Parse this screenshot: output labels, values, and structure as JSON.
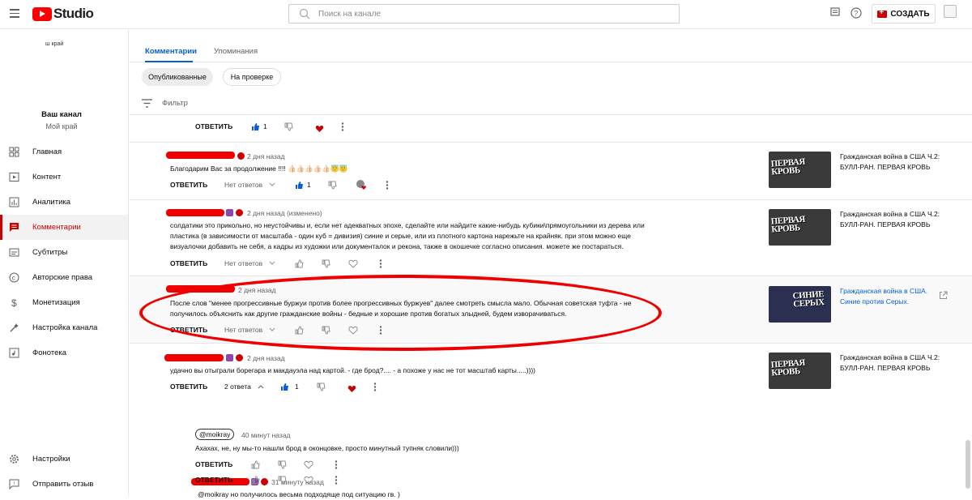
{
  "header": {
    "logo_text": "Studio",
    "search_placeholder": "Поиск на канале",
    "create_label": "СОЗДАТЬ"
  },
  "sidebar": {
    "channel_logo_text": "ш край",
    "channel_title": "Ваш канал",
    "channel_name": "Мой край",
    "items": [
      {
        "label": "Главная",
        "icon": "dashboard-icon"
      },
      {
        "label": "Контент",
        "icon": "content-icon"
      },
      {
        "label": "Аналитика",
        "icon": "analytics-icon"
      },
      {
        "label": "Комментарии",
        "icon": "comments-icon",
        "active": true
      },
      {
        "label": "Субтитры",
        "icon": "subtitles-icon"
      },
      {
        "label": "Авторские права",
        "icon": "copyright-icon"
      },
      {
        "label": "Монетизация",
        "icon": "dollar-icon"
      },
      {
        "label": "Настройка канала",
        "icon": "customize-icon"
      },
      {
        "label": "Фонотека",
        "icon": "audio-library-icon"
      }
    ],
    "bottom_items": [
      {
        "label": "Настройки",
        "icon": "gear-icon"
      },
      {
        "label": "Отправить отзыв",
        "icon": "feedback-icon"
      }
    ]
  },
  "tabs": [
    {
      "label": "Комментарии",
      "active": true
    },
    {
      "label": "Упоминания"
    }
  ],
  "chips": [
    {
      "label": "Опубликованные",
      "selected": true
    },
    {
      "label": "На проверке"
    }
  ],
  "filter": {
    "label": "Фильтр"
  },
  "actions": {
    "reply": "ОТВЕТИТЬ",
    "no_replies": "Нет ответов",
    "two_replies": "2 ответа"
  },
  "comments": [
    {
      "id": "c0",
      "like_count": "1"
    },
    {
      "id": "c1",
      "time": "2 дня назад",
      "text": "Благодарим Вас за продолжение !!!! 👍🏻👍🏻👍🏻👍🏻👍🏻😇😇",
      "like_count": "1",
      "video_title": "Гражданская война в США Ч.2: БУЛЛ-РАН. ПЕРВАЯ КРОВЬ",
      "thumb_text": "ПЕРВАЯ КРОВЬ"
    },
    {
      "id": "c2",
      "time": "2 дня назад (изменено)",
      "text_lines": [
        "солдатики это прикольно, но неустойчивы и, если  нет адекватных эпохе, сделайте или найдите какие-нибудь кубики\\прямоугольники из дерева или",
        "пластика (в зависимости от масштаба - один куб = дивизия) синие и серые, или из плотного картона нарежьте на крайняк. при этом можно еще",
        "визуалочки добавить не себя, а кадры из художки или документалок и рекона, также в окошечке согласно описания. можете же постараться."
      ],
      "video_title": "Гражданская война в США Ч.2: БУЛЛ-РАН. ПЕРВАЯ КРОВЬ",
      "thumb_text": "ПЕРВАЯ КРОВЬ"
    },
    {
      "id": "c3",
      "time": "2 дня назад",
      "text_lines": [
        "После слов \"менее прогрессивные буржуи против более прогрессивных буржуев\" далее смотреть смысла мало. Обычная советская туфта - не",
        "получилось объяснить как другие гражданские войны - бедные и хорошие против богатых злыдней, будем изворачиваться."
      ],
      "video_title": "Гражданская война в США. Синие против Серых.",
      "thumb_text": "СИНИЕ СЕРЫХ"
    },
    {
      "id": "c4",
      "time": "2 дня назад",
      "text": "удачно вы отыграли борегара и макдауэла над картой.  - где брод?.... - а похоже у нас не тот масштаб карты.....))))",
      "like_count": "1",
      "video_title": "Гражданская война в США Ч.2: БУЛЛ-РАН. ПЕРВАЯ КРОВЬ",
      "thumb_text": "ПЕРВАЯ КРОВЬ"
    }
  ],
  "replies": [
    {
      "author": "@moikray",
      "time": "40 минут назад",
      "text": "Ахахах, не, ну мы-то нашли брод в оконцовке, просто минутный тупняк словили)))"
    },
    {
      "time": "31 минуту назад",
      "text": "@moikray  но получилось весьма подходяще под ситуацию гв.  )"
    }
  ],
  "colors": {
    "accent": "#065fd4",
    "brand": "#ff0000",
    "annotation": "#e00000"
  }
}
